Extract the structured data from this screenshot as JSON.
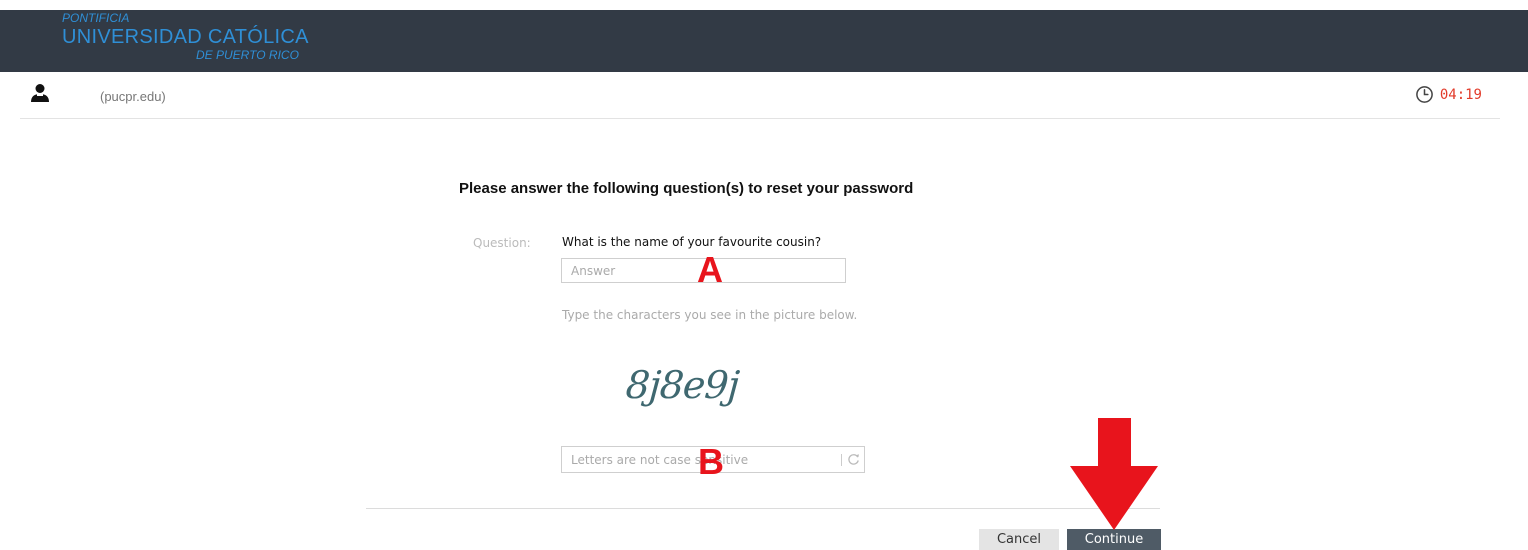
{
  "header": {
    "logo_line1": "PONTIFICIA",
    "logo_line2": "UNIVERSIDAD CATÓLICA",
    "logo_line3": "DE PUERTO RICO"
  },
  "userbar": {
    "domain": "(pucpr.edu)",
    "user_icon": "user-icon",
    "timer_icon": "clock-icon",
    "timer": "04:19"
  },
  "form": {
    "title": "Please answer the following question(s) to reset your password",
    "question_label": "Question:",
    "question_text": "What is the name of your favourite cousin?",
    "answer_placeholder": "Answer",
    "captcha_hint": "Type the characters you see in the picture below.",
    "captcha_text": "8j8e9j",
    "captcha_placeholder": "Letters are not case sensitive",
    "refresh_icon": "refresh-icon"
  },
  "annotations": {
    "marker_a": "A",
    "marker_b": "B",
    "arrow_color": "#e8141c"
  },
  "buttons": {
    "cancel": "Cancel",
    "continue": "Continue"
  },
  "colors": {
    "header_bg": "#323a45",
    "brand": "#2f8fd6",
    "timer": "#e23b2a",
    "primary_button": "#4f5b66"
  }
}
